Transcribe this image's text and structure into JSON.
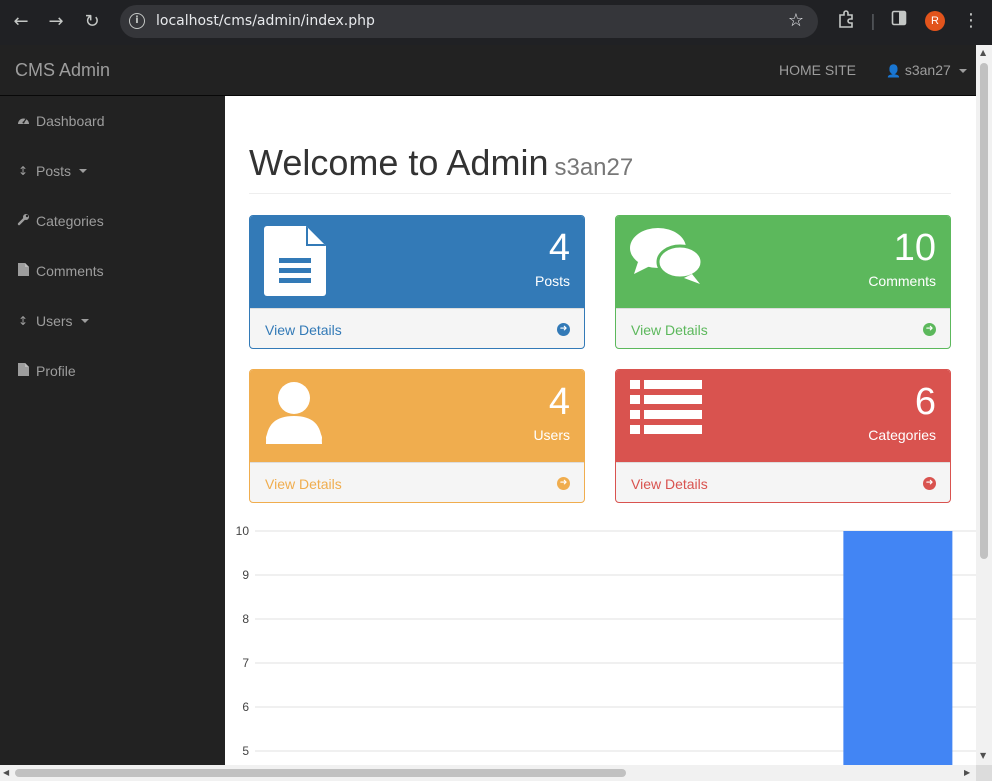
{
  "browser": {
    "url": "localhost/cms/admin/index.php",
    "profile_initial": "R"
  },
  "navbar": {
    "brand": "CMS Admin",
    "home_link": "HOME SITE",
    "user": "s3an27"
  },
  "sidebar": {
    "items": [
      {
        "label": "Dashboard",
        "icon": "dashboard-icon"
      },
      {
        "label": "Posts",
        "icon": "arrows-v-icon",
        "dropdown": true
      },
      {
        "label": "Categories",
        "icon": "wrench-icon"
      },
      {
        "label": "Comments",
        "icon": "file-icon"
      },
      {
        "label": "Users",
        "icon": "arrows-v-icon",
        "dropdown": true
      },
      {
        "label": "Profile",
        "icon": "file-icon"
      }
    ]
  },
  "header": {
    "title": "Welcome to Admin",
    "subtitle": "s3an27"
  },
  "panels": [
    {
      "count": "4",
      "label": "Posts",
      "link": "View Details",
      "color": "#337ab7",
      "icon": "file-text-icon"
    },
    {
      "count": "10",
      "label": "Comments",
      "link": "View Details",
      "color": "#5cb85c",
      "icon": "comments-icon"
    },
    {
      "count": "4",
      "label": "Users",
      "link": "View Details",
      "color": "#f0ad4e",
      "icon": "user-icon"
    },
    {
      "count": "6",
      "label": "Categories",
      "link": "View Details",
      "color": "#d9534f",
      "icon": "list-icon"
    }
  ],
  "chart_data": {
    "type": "bar",
    "categories": [
      "",
      "",
      "",
      ""
    ],
    "values": [
      null,
      null,
      null,
      10
    ],
    "bar_color": "#4285f4",
    "y_ticks": [
      5,
      6,
      7,
      8,
      9,
      10
    ],
    "ylim_visible": [
      5,
      10
    ]
  }
}
